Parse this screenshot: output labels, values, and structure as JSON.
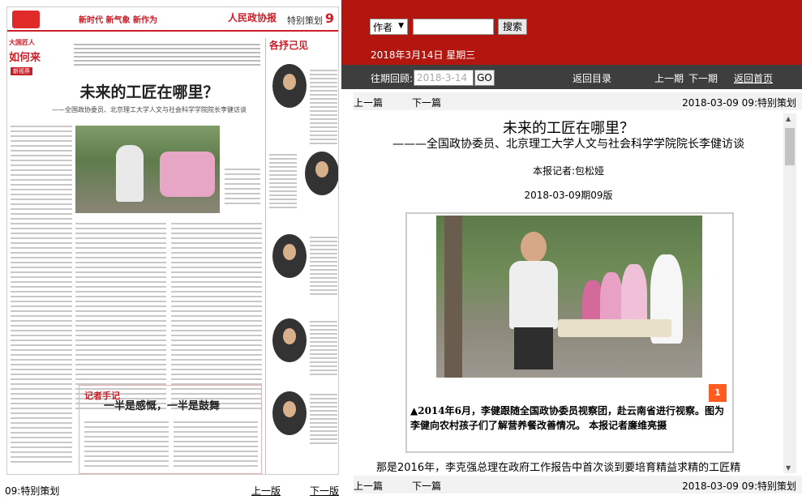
{
  "scan": {
    "slogan": "新时代 新气象 新作为",
    "paper_name": "人民政协报",
    "section": "特别策划",
    "page_num": "9",
    "tag_top": "大国匠人",
    "tag_main": "如何来",
    "tag_small": "新视界",
    "title": "未来的工匠在哪里？",
    "subtitle": "——全国政协委员、北京理工大学人文与社会科学学院院长李健访谈",
    "sidebar_head": "各抒己见",
    "box_label": "记者手记",
    "box_title": "一半是感慨，一半是鼓舞"
  },
  "left_footer": {
    "section": "09:特别策划",
    "prev_page": "上一版",
    "next_page": "下一版"
  },
  "topbar": {
    "author_select": "作者",
    "search_placeholder": "",
    "search_button": "搜索",
    "date": "2018年3月14日 星期三"
  },
  "navbar": {
    "past_label": "往期回顾:",
    "date_input": "2018-3-14",
    "go_button": "GO",
    "back_catalog": "返回目录",
    "prev_issue": "上一期",
    "next_issue": "下一期",
    "home": "返回首页"
  },
  "article_bar": {
    "prev": "上一篇",
    "next": "下一篇",
    "info": "2018-03-09 09:特别策划"
  },
  "article": {
    "title": "未来的工匠在哪里？",
    "subtitle": "———全国政协委员、北京理工大学人文与社会科学学院院长李健访谈",
    "reporter": "本报记者:包松娅",
    "date_page": "2018-03-09期09版",
    "badge": "1",
    "caption": "▲2014年6月，李健跟随全国政协委员视察团，赴云南省进行视察。图为李健向农村孩子们了解营养餐改善情况。 本报记者廉维亮摄",
    "paragraph": "那是2016年，李克强总理在政府工作报告中首次谈到要培育精益求精的工匠精"
  },
  "colors": {
    "topbar": "#b3150f",
    "navbar": "#3e3e3e",
    "badge": "#ff5c1f"
  }
}
